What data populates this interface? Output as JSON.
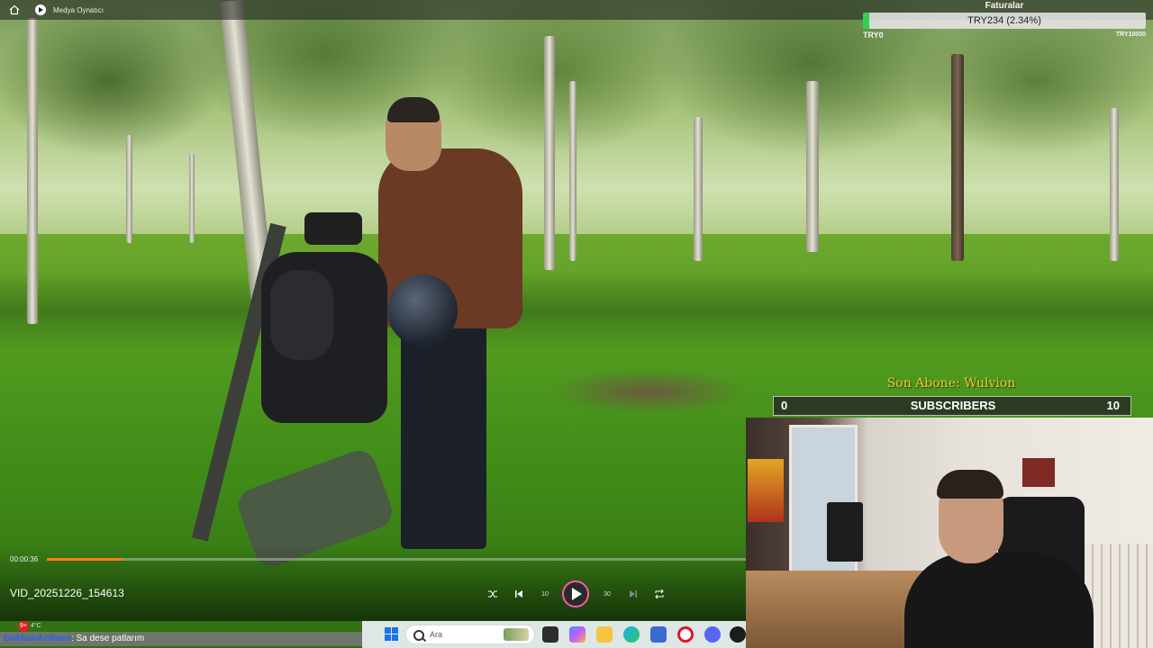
{
  "window": {
    "title": "Medya Oynatıcı"
  },
  "donation_goal": {
    "title": "Faturalar",
    "progress_text": "TRY234 (2.34%)",
    "progress_fraction": 0.0234,
    "min_label": "TRY0",
    "max_label": "TRY10000",
    "fill_color": "#2fd14d"
  },
  "subscriber_goal": {
    "latest_subscriber": "Son Abone: Wulvion",
    "min": "0",
    "label": "SUBSCRIBERS",
    "max": "10",
    "accent_color": "#f3c437"
  },
  "player": {
    "current_time": "00:00:36",
    "progress_fraction": 0.11,
    "accent_color": "#ff7a1a",
    "filename": "VID_20251226_154613",
    "controls": [
      {
        "name": "shuffle-button",
        "icon": "shuffle-icon"
      },
      {
        "name": "previous-button",
        "icon": "previous-icon"
      },
      {
        "name": "rewind-10-button",
        "icon": "rewind-10-icon",
        "label": "10"
      },
      {
        "name": "play-button",
        "icon": "play-icon"
      },
      {
        "name": "forward-30-button",
        "icon": "forward-30-icon",
        "label": "30"
      },
      {
        "name": "next-button",
        "icon": "next-icon"
      },
      {
        "name": "repeat-button",
        "icon": "repeat-icon"
      }
    ]
  },
  "chat": {
    "user": "GokhanAcikses",
    "message": ": Sa dese patlarım"
  },
  "weather": {
    "badge": "9+",
    "temp": "4°C"
  },
  "taskbar": {
    "search_placeholder": "Ara",
    "apps": [
      "start-icon",
      "search-icon",
      "task-view-icon",
      "copilot-icon",
      "file-explorer-icon",
      "edge-icon",
      "store-icon",
      "opera-icon",
      "discord-icon",
      "media-icon"
    ]
  }
}
